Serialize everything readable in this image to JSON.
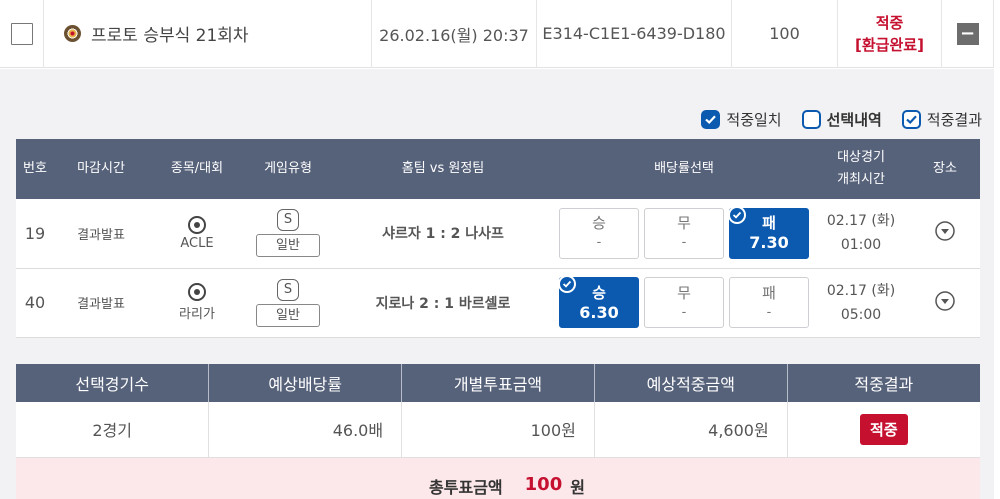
{
  "bet": {
    "name": "프로토 승부식 21회차",
    "datetime": "26.02.16(월) 20:37",
    "code": "E314-C1E1-6439-D180",
    "amount": "100",
    "result_line1": "적중",
    "result_line2": "[환급완료]"
  },
  "legend": [
    {
      "label": "적중일치",
      "icon": "check-filled"
    },
    {
      "label": "선택내역",
      "icon": "box-outline"
    },
    {
      "label": "적중결과",
      "icon": "check-outline"
    }
  ],
  "games_table": {
    "headers": {
      "no": "번호",
      "deadline": "마감시간",
      "sport": "종목/대회",
      "type": "게임유형",
      "teams": "홈팀 vs 원정팀",
      "odds": "배당률선택",
      "time_line1": "대상경기",
      "time_line2": "개최시간",
      "venue": "장소"
    },
    "rows": [
      {
        "no": "19",
        "status": "결과발표",
        "league": "ACLE",
        "s_badge": "S",
        "type": "일반",
        "match": "샤르자 1 : 2 나사프",
        "odds": [
          {
            "label": "승",
            "value": "-"
          },
          {
            "label": "무",
            "value": "-"
          },
          {
            "label": "패",
            "value": "7.30"
          }
        ],
        "selected_index": 2,
        "date": "02.17 (화)",
        "time": "01:00"
      },
      {
        "no": "40",
        "status": "결과발표",
        "league": "라리가",
        "s_badge": "S",
        "type": "일반",
        "match": "지로나 2 : 1 바르셀로",
        "odds": [
          {
            "label": "승",
            "value": "6.30"
          },
          {
            "label": "무",
            "value": "-"
          },
          {
            "label": "패",
            "value": "-"
          }
        ],
        "selected_index": 0,
        "date": "02.17 (화)",
        "time": "05:00"
      }
    ]
  },
  "summary": {
    "headers": [
      "선택경기수",
      "예상배당률",
      "개별투표금액",
      "예상적중금액",
      "적중결과"
    ],
    "values": [
      "2경기",
      "46.0배",
      "100원",
      "4,600원"
    ],
    "result": "적중"
  },
  "total": {
    "label": "총투표금액",
    "value": "100",
    "unit": "원"
  },
  "colors": {
    "accent_blue": "#0b5ab0",
    "header_bg": "#56617a",
    "hit_red": "#c5102f",
    "total_bg": "#fce8ea"
  }
}
